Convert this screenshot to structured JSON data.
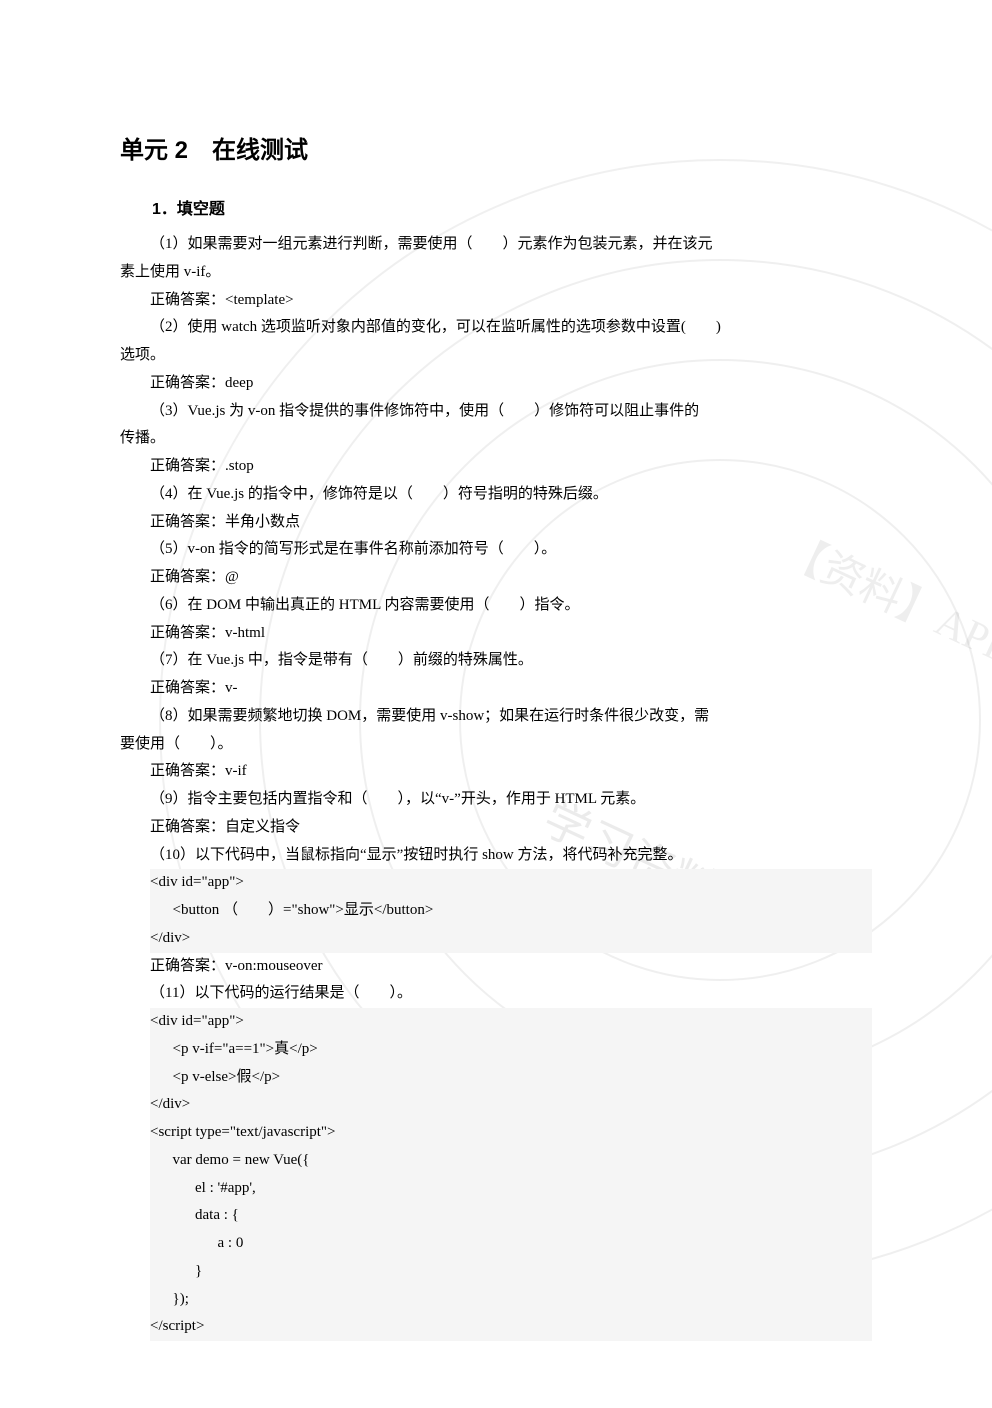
{
  "title": "单元 2　在线测试",
  "section1_header": "1．填空题",
  "q1_line1": "（1）如果需要对一组元素进行判断，需要使用（　　）元素作为包装元素，并在该元",
  "q1_line2": "素上使用 v-if。",
  "a1": "正确答案：<template>",
  "q2_line1": "（2）使用 watch 选项监听对象内部值的变化，可以在监听属性的选项参数中设置(　　)",
  "q2_line2": "选项。",
  "a2": "正确答案：deep",
  "q3_line1": "（3）Vue.js 为 v-on 指令提供的事件修饰符中，使用（　　）修饰符可以阻止事件的",
  "q3_line2": "传播。",
  "a3": "正确答案：.stop",
  "q4": "（4）在 Vue.js 的指令中，修饰符是以（　　）符号指明的特殊后缀。",
  "a4": "正确答案：半角小数点",
  "q5": "（5）v-on 指令的简写形式是在事件名称前添加符号（　　）。",
  "a5": "正确答案：@",
  "q6": "（6）在 DOM 中输出真正的 HTML 内容需要使用（　　）指令。",
  "a6": "正确答案：v-html",
  "q7": "（7）在 Vue.js 中，指令是带有（　　）前缀的特殊属性。",
  "a7": "正确答案：v-",
  "q8_line1": "（8）如果需要频繁地切换 DOM，需要使用 v-show；如果在运行时条件很少改变，需",
  "q8_line2": "要使用（　　）。",
  "a8": "正确答案：v-if",
  "q9": "（9）指令主要包括内置指令和（　　），以“v-”开头，作用于 HTML 元素。",
  "a9": "正确答案：自定义指令",
  "q10": "（10）以下代码中，当鼠标指向“显示”按钮时执行 show 方法，将代码补充完整。",
  "code10_l1": "<div id=\"app\">",
  "code10_l2": "      <button （　　）=\"show\">显示</button>",
  "code10_l3": "</div>",
  "a10": "正确答案：v-on:mouseover",
  "q11": "（11）以下代码的运行结果是（　　）。",
  "code11_l1": "<div id=\"app\">",
  "code11_l2": "      <p v-if=\"a==1\">真</p>",
  "code11_l3": "      <p v-else>假</p>",
  "code11_l4": "</div>",
  "code11_l5": "<script type=\"text/javascript\">",
  "code11_l6": "      var demo = new Vue({",
  "code11_l7": "            el : '#app',",
  "code11_l8": "            data : {",
  "code11_l9": "                  a : 0",
  "code11_l10": "            }",
  "code11_l11": "      });",
  "code11_l12": "</script>"
}
